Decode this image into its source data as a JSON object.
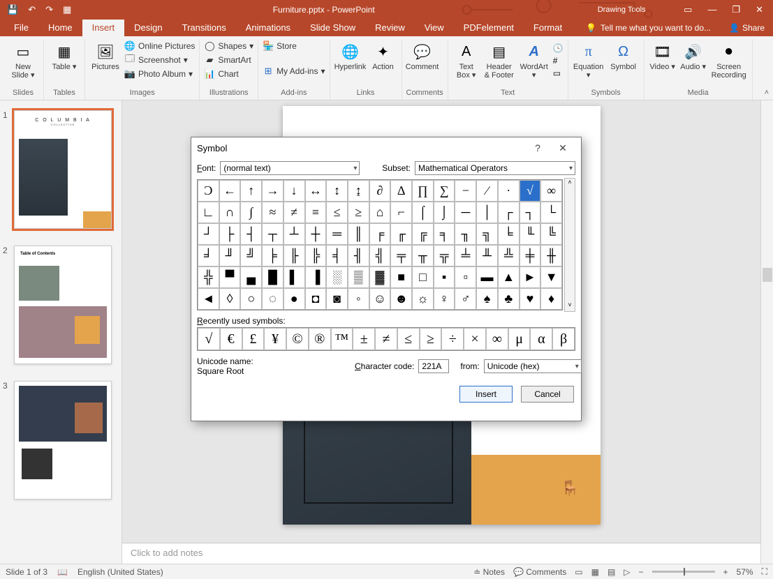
{
  "app": {
    "document_title": "Furniture.pptx - PowerPoint",
    "context_tab": "Drawing Tools",
    "qat": {
      "save": "💾",
      "undo": "↶",
      "redo": "↷",
      "start": "▦"
    },
    "win": {
      "min": "—",
      "restore": "❐",
      "close": "✕",
      "opts": "▭"
    }
  },
  "tabs": {
    "file": "File",
    "home": "Home",
    "insert": "Insert",
    "design": "Design",
    "transitions": "Transitions",
    "animations": "Animations",
    "slideshow": "Slide Show",
    "review": "Review",
    "view": "View",
    "pdfelement": "PDFelement",
    "format": "Format",
    "tellme": "Tell me what you want to do...",
    "share": "Share"
  },
  "ribbon": {
    "groups": {
      "slides": "Slides",
      "tables": "Tables",
      "images": "Images",
      "illustrations": "Illustrations",
      "addins": "Add-ins",
      "links": "Links",
      "comments": "Comments",
      "text": "Text",
      "symbols": "Symbols",
      "media": "Media"
    },
    "new_slide": "New Slide",
    "table": "Table",
    "pictures": "Pictures",
    "online_pictures": "Online Pictures",
    "screenshot": "Screenshot",
    "photo_album": "Photo Album",
    "shapes": "Shapes",
    "smartart": "SmartArt",
    "chart": "Chart",
    "store": "Store",
    "my_addins": "My Add-ins",
    "hyperlink": "Hyperlink",
    "action": "Action",
    "comment": "Comment",
    "text_box": "Text Box",
    "header_footer": "Header & Footer",
    "wordart": "WordArt",
    "equation": "Equation",
    "symbol": "Symbol",
    "video": "Video",
    "audio": "Audio",
    "screen_recording": "Screen Recording"
  },
  "dialog": {
    "title": "Symbol",
    "help": "?",
    "close": "✕",
    "font_label": "Font:",
    "font_value": "(normal text)",
    "subset_label": "Subset:",
    "subset_value": "Mathematical Operators",
    "recent_label": "Recently used symbols:",
    "unicode_name_label": "Unicode name:",
    "unicode_name_value": "Square Root",
    "char_code_label": "Character code:",
    "char_code_value": "221A",
    "from_label": "from:",
    "from_value": "Unicode (hex)",
    "insert": "Insert",
    "cancel": "Cancel",
    "grid_symbols": [
      "Ͻ",
      "←",
      "↑",
      "→",
      "↓",
      "↔",
      "↕",
      "↨",
      "∂",
      "∆",
      "∏",
      "∑",
      "−",
      "∕",
      "∙",
      "√",
      "∞",
      "∟",
      "∩",
      "∫",
      "≈",
      "≠",
      "≡",
      "≤",
      "≥",
      "⌂",
      "⌐",
      "⌠",
      "⌡",
      "─",
      "│",
      "┌",
      "┐",
      "└",
      "┘",
      "├",
      "┤",
      "┬",
      "┴",
      "┼",
      "═",
      "║",
      "╒",
      "╓",
      "╔",
      "╕",
      "╖",
      "╗",
      "╘",
      "╙",
      "╚",
      "╛",
      "╜",
      "╝",
      "╞",
      "╟",
      "╠",
      "╡",
      "╢",
      "╣",
      "╤",
      "╥",
      "╦",
      "╧",
      "╨",
      "╩",
      "╪",
      "╫",
      "╬",
      "▀",
      "▄",
      "█",
      "▌",
      "▐",
      "░",
      "▒",
      "▓",
      "■",
      "□",
      "▪",
      "▫",
      "▬",
      "▲",
      "►",
      "▼",
      "◄",
      "◊",
      "○",
      "◌",
      "●",
      "◘",
      "◙",
      "◦",
      "☺",
      "☻",
      "☼",
      "♀",
      "♂",
      "♠",
      "♣",
      "♥",
      "♦"
    ],
    "selected_index": 15,
    "recent_symbols": [
      "√",
      "€",
      "£",
      "¥",
      "©",
      "®",
      "™",
      "±",
      "≠",
      "≤",
      "≥",
      "÷",
      "×",
      "∞",
      "μ",
      "α",
      "β"
    ]
  },
  "thumbs": {
    "n1": "1",
    "n2": "2",
    "n3": "3",
    "t1_brand": "C O L U M B I A",
    "t1_sub": "COLLECTIVE",
    "t2_head": "Table of Contents"
  },
  "canvas": {
    "notes_placeholder": "Click to add notes"
  },
  "status": {
    "slide": "Slide 1 of 3",
    "lang": "English (United States)",
    "notes": "Notes",
    "comments": "Comments",
    "zoom": "57%"
  }
}
